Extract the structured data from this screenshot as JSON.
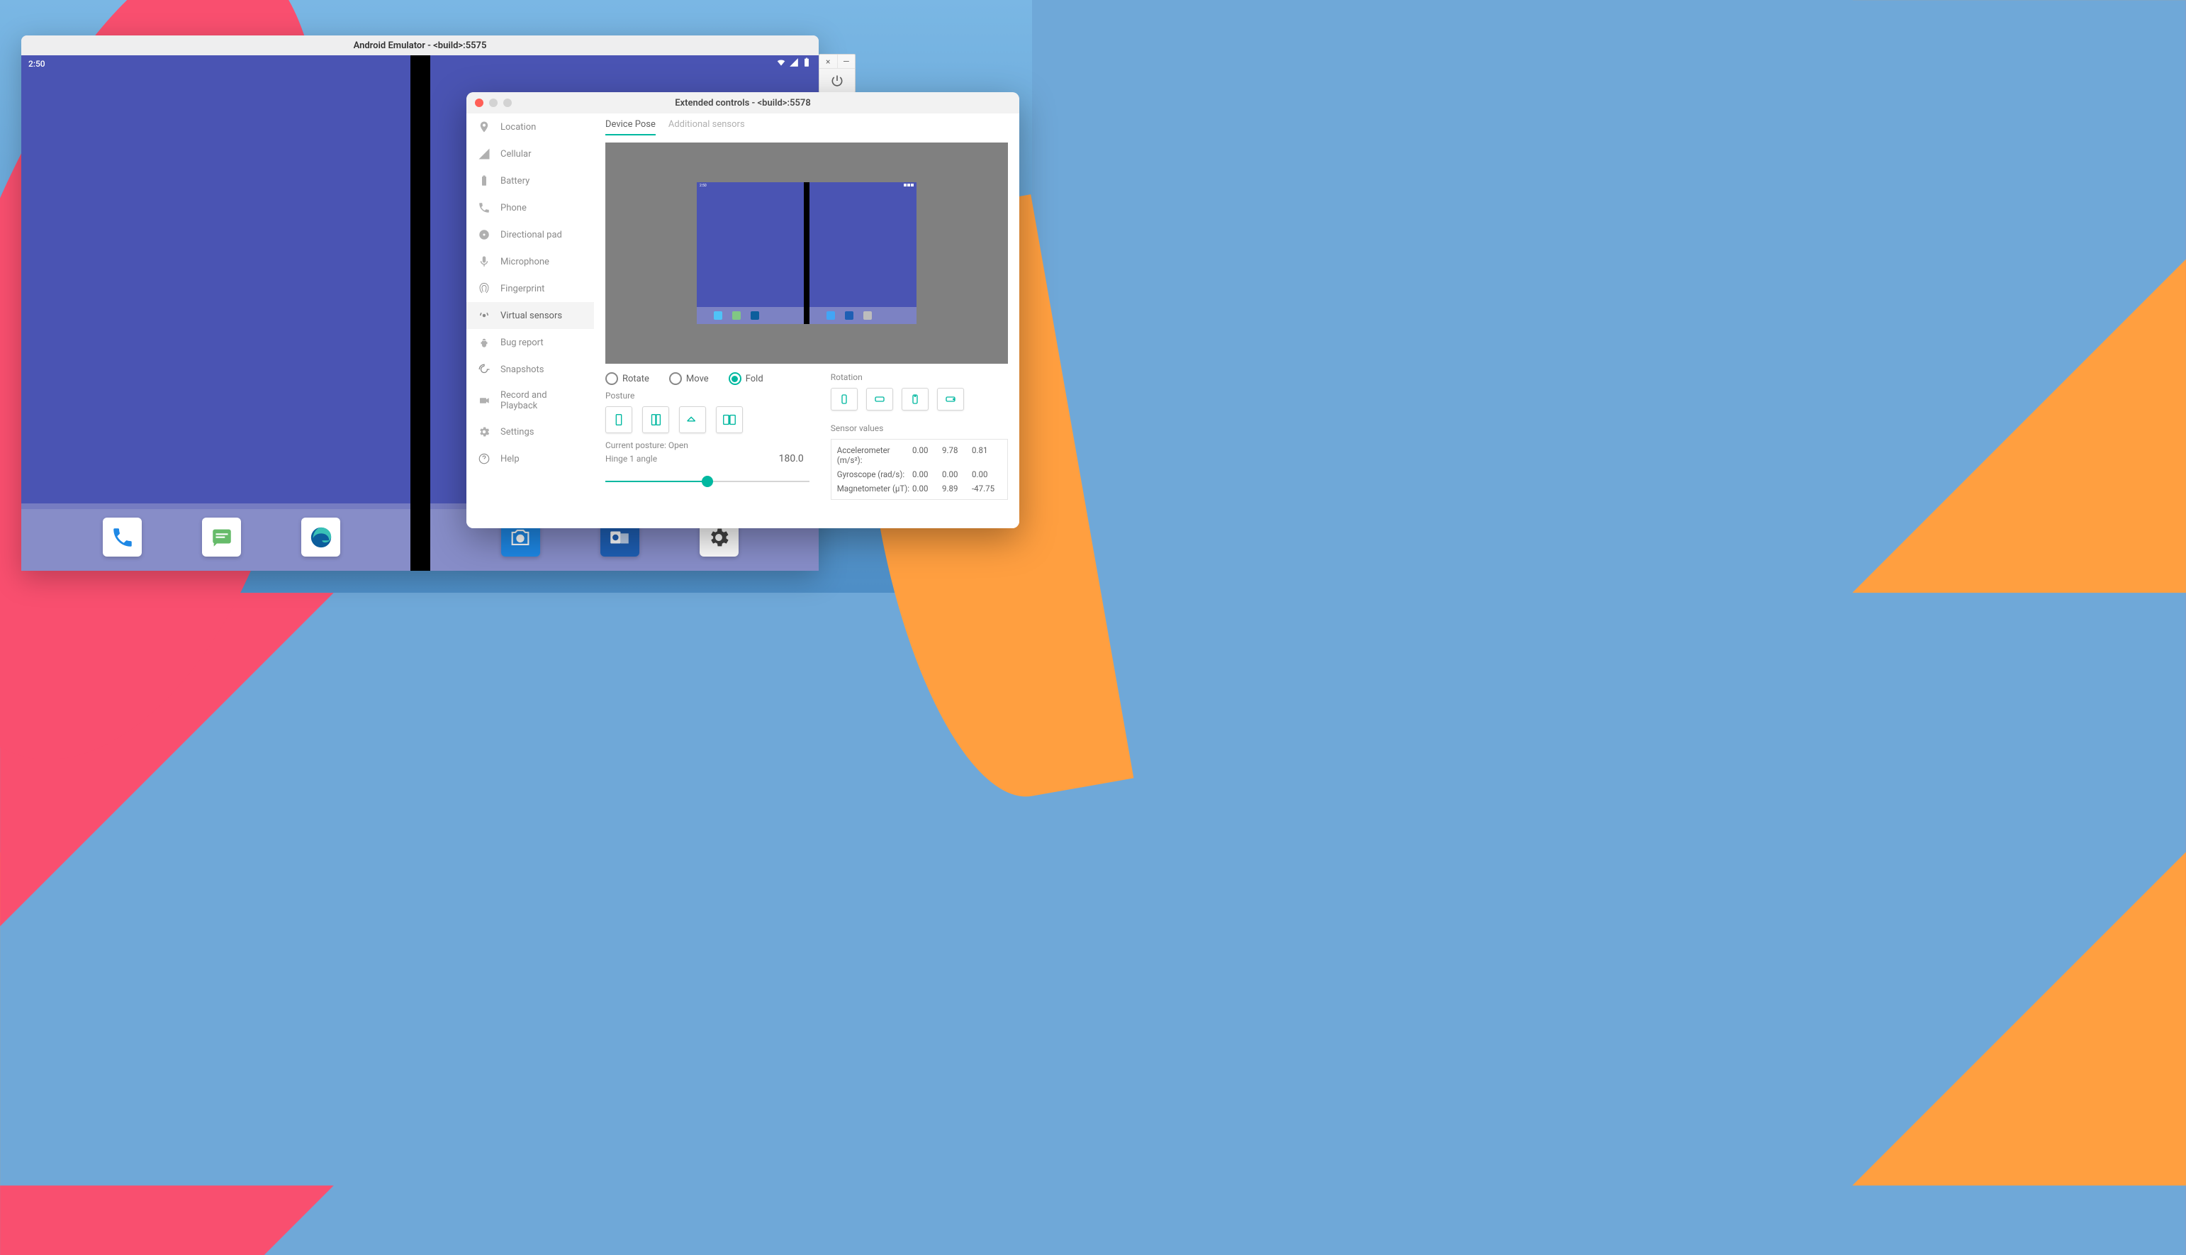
{
  "emulator": {
    "title": "Android Emulator - <build>:5575",
    "clock": "2:50",
    "dock_left": [
      "phone",
      "messages",
      "edge"
    ],
    "dock_right": [
      "camera",
      "outlook",
      "settings"
    ]
  },
  "side_toolbar": {
    "close": "×",
    "minimize": "—"
  },
  "ext": {
    "title": "Extended controls - <build>:5578",
    "sidebar": [
      {
        "icon": "location",
        "label": "Location"
      },
      {
        "icon": "cellular",
        "label": "Cellular"
      },
      {
        "icon": "battery",
        "label": "Battery"
      },
      {
        "icon": "phone",
        "label": "Phone"
      },
      {
        "icon": "dpad",
        "label": "Directional pad"
      },
      {
        "icon": "mic",
        "label": "Microphone"
      },
      {
        "icon": "fingerprint",
        "label": "Fingerprint"
      },
      {
        "icon": "sensors",
        "label": "Virtual sensors",
        "active": true
      },
      {
        "icon": "bug",
        "label": "Bug report"
      },
      {
        "icon": "snapshot",
        "label": "Snapshots"
      },
      {
        "icon": "record",
        "label": "Record and Playback"
      },
      {
        "icon": "settings",
        "label": "Settings"
      },
      {
        "icon": "help",
        "label": "Help"
      }
    ],
    "tabs": [
      {
        "label": "Device Pose",
        "active": true
      },
      {
        "label": "Additional sensors"
      }
    ],
    "modes": [
      {
        "label": "Rotate"
      },
      {
        "label": "Move"
      },
      {
        "label": "Fold",
        "selected": true
      }
    ],
    "posture_label": "Posture",
    "current_posture": "Current posture: Open",
    "hinge_label": "Hinge 1 angle",
    "hinge_value": "180.0",
    "rotation_label": "Rotation",
    "sensor_values_label": "Sensor values",
    "sensors": [
      {
        "label": "Accelerometer (m/s²):",
        "v1": "0.00",
        "v2": "9.78",
        "v3": "0.81"
      },
      {
        "label": "Gyroscope (rad/s):",
        "v1": "0.00",
        "v2": "0.00",
        "v3": "0.00"
      },
      {
        "label": "Magnetometer (μT):",
        "v1": "0.00",
        "v2": "9.89",
        "v3": "-47.75"
      }
    ]
  }
}
